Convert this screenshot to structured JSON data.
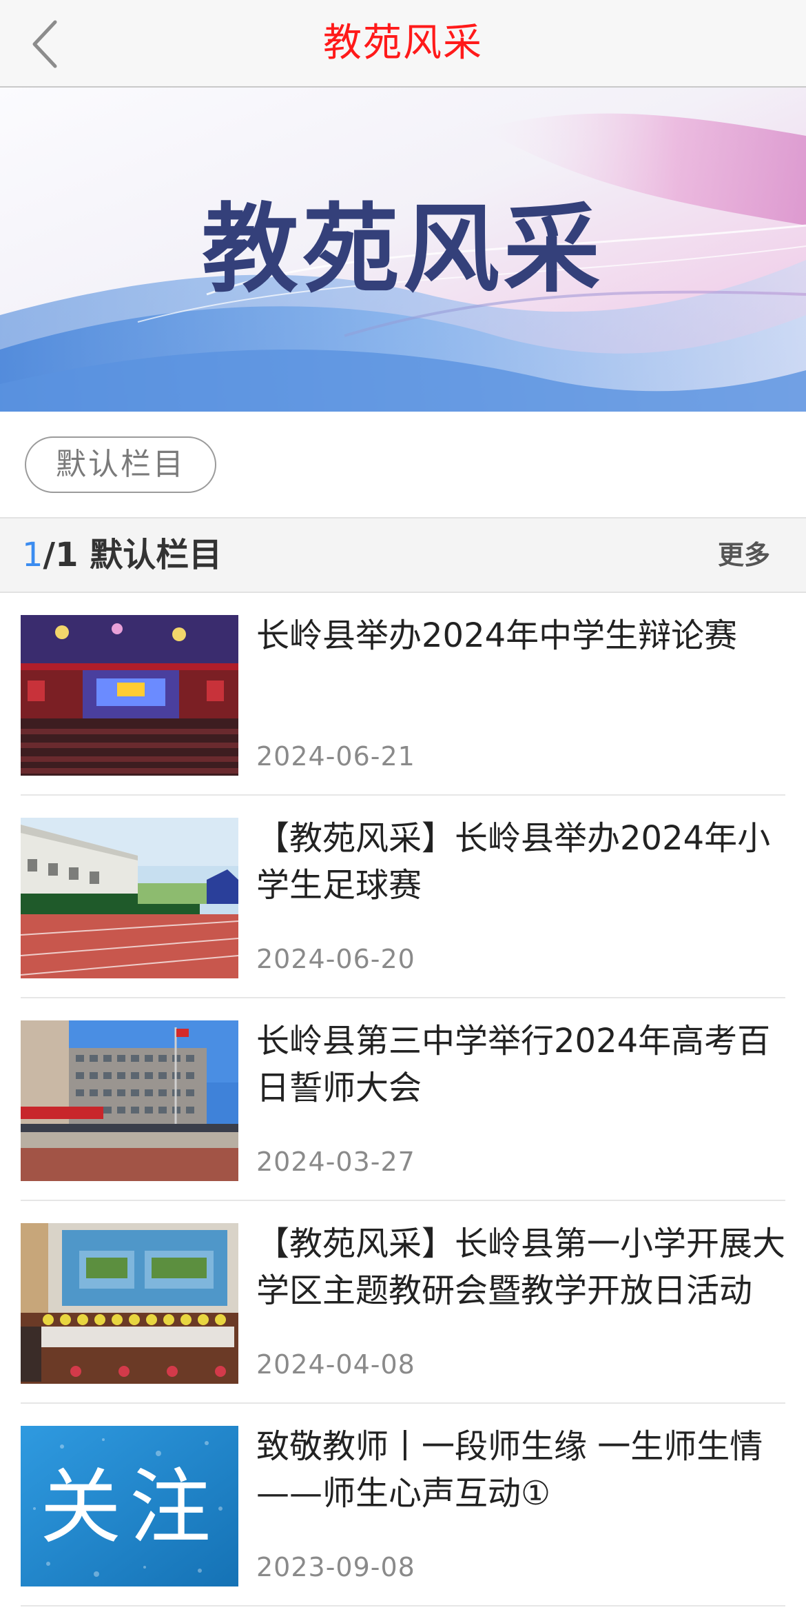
{
  "header": {
    "title": "教苑风采",
    "back_icon": "chevron-left-icon"
  },
  "banner": {
    "text": "教苑风采"
  },
  "category_tabs": [
    {
      "label": "默认栏目",
      "selected": true
    }
  ],
  "section": {
    "page_current": "1",
    "page_rest": "/1 默认栏目",
    "more_label": "更多"
  },
  "news": [
    {
      "title": "长岭县举办2024年中学生辩论赛",
      "date": "2024-06-21"
    },
    {
      "title": "【教苑风采】长岭县举办2024年小学生足球赛",
      "date": "2024-06-20"
    },
    {
      "title": "长岭县第三中学举行2024年高考百日誓师大会",
      "date": "2024-03-27"
    },
    {
      "title": "【教苑风采】长岭县第一小学开展大学区主题教研会暨教学开放日活动",
      "date": "2024-04-08"
    },
    {
      "title": "致敬教师丨一段师生缘 一生师生情——师生心声互动①",
      "date": "2023-09-08"
    }
  ],
  "thumb_text": {
    "item5": "关注"
  },
  "colors": {
    "header_title": "#ff1a1a",
    "page_current": "#3b8cf0",
    "banner_text": "#34407a"
  }
}
